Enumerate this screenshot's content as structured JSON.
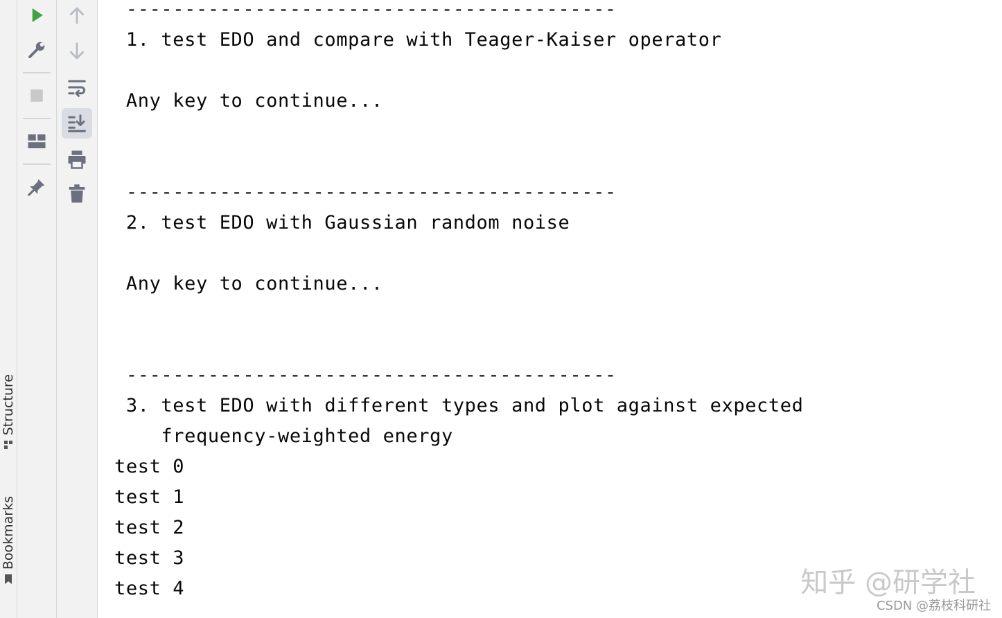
{
  "side_tabs": {
    "structure": "Structure",
    "bookmarks": "Bookmarks"
  },
  "toolbar": {
    "run": "rerun-icon",
    "settings": "wrench-icon",
    "stop": "stop-icon",
    "layout": "layout-icon",
    "pin": "pin-icon",
    "up": "arrow-up-icon",
    "down": "arrow-down-icon",
    "wrap": "soft-wrap-icon",
    "scroll_end": "scroll-to-end-icon",
    "print": "print-icon",
    "clear": "trash-icon"
  },
  "console": {
    "lines": [
      " ------------------------------------------",
      " 1. test EDO and compare with Teager-Kaiser operator",
      " Any key to continue...",
      " ------------------------------------------",
      " 2. test EDO with Gaussian random noise",
      " Any key to continue...",
      " ------------------------------------------",
      " 3. test EDO with different types and plot against expected",
      "    frequency-weighted energy",
      "test 0",
      "test 1",
      "test 2",
      "test 3",
      "test 4"
    ]
  },
  "watermark": {
    "zhihu": "知乎 @研学社",
    "csdn": "CSDN @荔枝科研社"
  },
  "colors": {
    "run_green": "#3fa344",
    "icon_gray": "#6c707e",
    "disabled_gray": "#b8bcc4"
  }
}
